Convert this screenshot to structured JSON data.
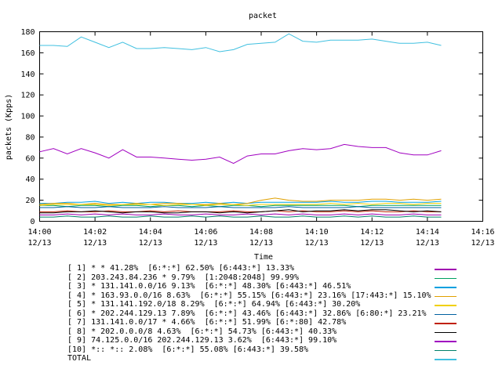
{
  "chart_data": {
    "type": "line",
    "title": "packet",
    "xlabel": "Time",
    "ylabel": "packets (Kpps)",
    "ylim": [
      0,
      180
    ],
    "xlim": [
      0,
      16
    ],
    "yticks": [
      "0",
      "20",
      "40",
      "60",
      "80",
      "100",
      "120",
      "140",
      "160",
      "180"
    ],
    "xticks": [
      {
        "at": 0,
        "time": "14:00",
        "date": "12/13"
      },
      {
        "at": 2,
        "time": "14:02",
        "date": "12/13"
      },
      {
        "at": 4,
        "time": "14:04",
        "date": "12/13"
      },
      {
        "at": 6,
        "time": "14:06",
        "date": "12/13"
      },
      {
        "at": 8,
        "time": "14:08",
        "date": "12/13"
      },
      {
        "at": 10,
        "time": "14:10",
        "date": "12/13"
      },
      {
        "at": 12,
        "time": "14:12",
        "date": "12/13"
      },
      {
        "at": 14,
        "time": "14:14",
        "date": "12/13"
      },
      {
        "at": 16,
        "time": "14:16",
        "date": "12/13"
      }
    ],
    "grid": false,
    "legend_position": "bottom",
    "x": [
      0,
      0.5,
      1,
      1.5,
      2,
      2.5,
      3,
      3.5,
      4,
      4.5,
      5,
      5.5,
      6,
      6.5,
      7,
      7.5,
      8,
      8.5,
      9,
      9.5,
      10,
      10.5,
      11,
      11.5,
      12,
      12.5,
      13,
      13.5,
      14,
      14.5
    ],
    "series": [
      {
        "name": "[ 1] * * 41.28%  [6:*:*] 62.50% [6:443:*] 13.33%",
        "color": "#a000b0",
        "values": [
          6,
          6,
          7,
          6,
          7,
          6,
          7,
          6,
          6,
          7,
          6,
          6,
          7,
          6,
          6,
          7,
          6,
          7,
          6,
          7,
          6,
          6,
          7,
          6,
          7,
          6,
          6,
          7,
          6,
          6
        ]
      },
      {
        "name": "[ 2] 203.243.84.236 * 9.79%  [1:2048:2048] 99.99%",
        "color": "#00a060",
        "values": [
          15,
          15,
          14,
          15,
          15,
          14,
          15,
          15,
          14,
          15,
          15,
          14,
          15,
          14,
          15,
          15,
          14,
          15,
          15,
          15,
          15,
          15,
          15,
          14,
          15,
          15,
          15,
          15,
          15,
          15
        ]
      },
      {
        "name": "[ 3] * 131.141.0.0/16 9.13%  [6:*:*] 48.30% [6:443:*] 46.51%",
        "color": "#00a0e0",
        "values": [
          17,
          17,
          18,
          18,
          19,
          17,
          18,
          17,
          18,
          18,
          17,
          17,
          18,
          17,
          18,
          17,
          18,
          18,
          18,
          18,
          18,
          19,
          18,
          18,
          19,
          19,
          18,
          18,
          18,
          19
        ]
      },
      {
        "name": "[ 4] * 163.93.0.0/16 8.63%  [6:*:*] 55.15% [6:443:*] 23.16% [17:443:*] 15.10%",
        "color": "#e0a000",
        "values": [
          16,
          17,
          17,
          16,
          17,
          16,
          16,
          17,
          16,
          17,
          17,
          16,
          16,
          17,
          16,
          17,
          20,
          22,
          20,
          19,
          19,
          20,
          20,
          20,
          21,
          21,
          20,
          21,
          20,
          21
        ]
      },
      {
        "name": "[ 5] * 131.141.192.0/18 8.29%  [6:*:*] 64.94% [6:443:*] 30.20%",
        "color": "#f0d000",
        "values": [
          15,
          16,
          16,
          16,
          16,
          15,
          16,
          16,
          16,
          15,
          16,
          16,
          15,
          16,
          16,
          15,
          16,
          16,
          16,
          16,
          16,
          17,
          16,
          17,
          16,
          17,
          17,
          16,
          17,
          17
        ]
      },
      {
        "name": "[ 6] * 202.244.129.13 7.89%  [6:*:*] 43.46% [6:443:*] 32.86% [6:80:*] 23.21%",
        "color": "#0060a0",
        "values": [
          13,
          13,
          14,
          13,
          13,
          14,
          13,
          13,
          13,
          14,
          13,
          13,
          13,
          14,
          13,
          13,
          13,
          13,
          14,
          13,
          13,
          13,
          13,
          14,
          13,
          13,
          13,
          13,
          13,
          13
        ]
      },
      {
        "name": "[ 7] 131.141.0.0/17 * 4.66%  [6:*:*] 51.99% [6:*:80] 42.78%",
        "color": "#c02000",
        "values": [
          9,
          9,
          10,
          9,
          9,
          10,
          9,
          9,
          10,
          9,
          10,
          9,
          9,
          9,
          10,
          9,
          9,
          10,
          9,
          10,
          9,
          9,
          10,
          9,
          10,
          9,
          9,
          10,
          9,
          9
        ]
      },
      {
        "name": "[ 8] * 202.0.0.0/8 4.63%  [6:*:*] 54.73% [6:443:*] 40.33%",
        "color": "#000000",
        "values": [
          8,
          8,
          9,
          9,
          10,
          9,
          8,
          9,
          9,
          8,
          8,
          9,
          9,
          8,
          9,
          8,
          9,
          10,
          11,
          9,
          10,
          10,
          11,
          10,
          11,
          11,
          10,
          9,
          10,
          9
        ]
      },
      {
        "name": "[ 9] 74.125.0.0/16 202.244.129.13 3.62%  [6:443:*] 99.10%",
        "color": "#a000c0",
        "values": [
          66,
          69,
          64,
          69,
          65,
          60,
          68,
          61,
          61,
          60,
          59,
          58,
          59,
          61,
          55,
          62,
          64,
          64,
          67,
          69,
          68,
          69,
          73,
          71,
          70,
          70,
          65,
          63,
          63,
          67
        ]
      },
      {
        "name": "[10] *:: *:: 2.08%  [6:*:*] 55.08% [6:443:*] 39.58%",
        "color": "#00806a",
        "values": [
          4,
          4,
          5,
          4,
          4,
          5,
          4,
          4,
          5,
          4,
          4,
          5,
          4,
          5,
          4,
          4,
          5,
          4,
          4,
          5,
          4,
          4,
          5,
          4,
          5,
          4,
          4,
          5,
          4,
          4
        ]
      },
      {
        "name": "TOTAL",
        "color": "#40c0e0",
        "values": [
          167,
          167,
          166,
          175,
          170,
          165,
          170,
          164,
          164,
          165,
          164,
          163,
          165,
          161,
          163,
          168,
          169,
          170,
          178,
          171,
          170,
          172,
          172,
          172,
          173,
          171,
          169,
          169,
          170,
          167
        ]
      }
    ]
  }
}
